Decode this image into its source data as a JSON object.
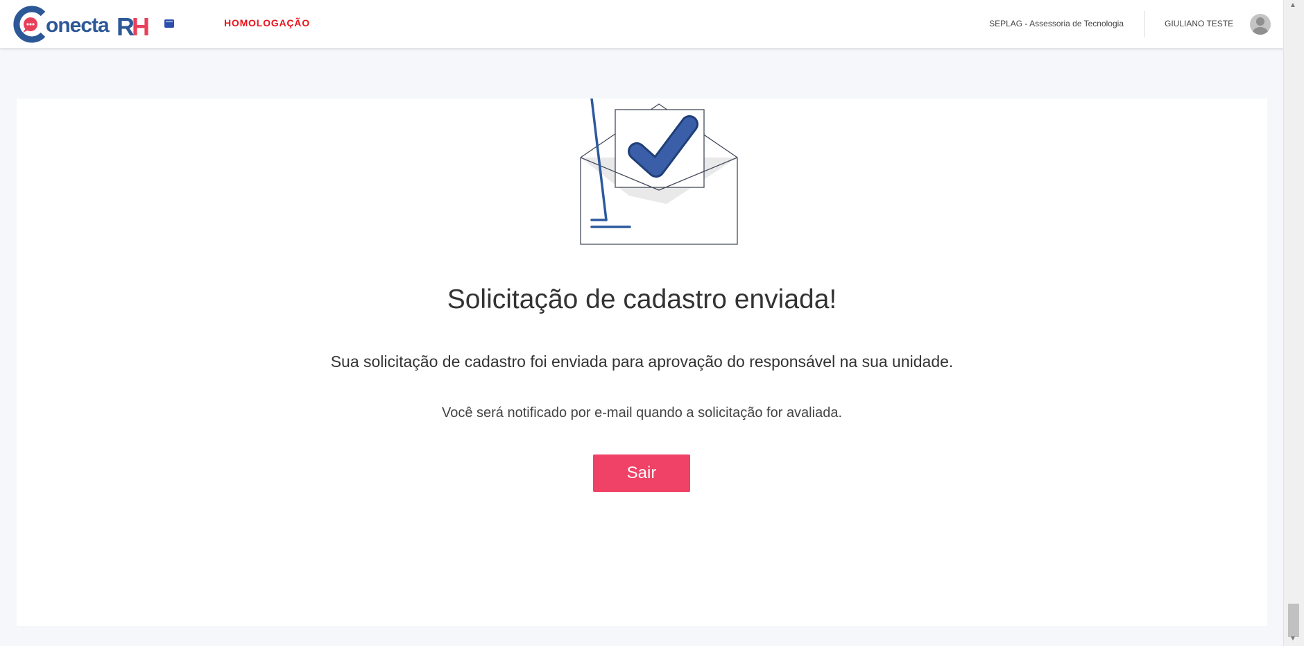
{
  "header": {
    "logo": {
      "text": "onecta",
      "rh_r": "R",
      "rh_h": "H",
      "brand_blue": "#2d5897",
      "brand_red": "#e8405a"
    },
    "menu_icon": "app-menu-icon",
    "environment_label": "HOMOLOGAÇÃO",
    "organization": "SEPLAG - Assessoria de Tecnologia",
    "user_name": "GIULIANO TESTE",
    "avatar_icon": "user-avatar-icon"
  },
  "main": {
    "illustration_icon": "envelope-check-icon",
    "title": "Solicitação de cadastro enviada!",
    "message": "Sua solicitação de cadastro foi enviada para aprovação do responsável na sua unidade.",
    "submessage": "Você será notificado por e-mail quando a solicitação for avaliada.",
    "exit_button_label": "Sair"
  },
  "scrollbar": {
    "up_icon": "▲",
    "down_icon": "▼"
  },
  "colors": {
    "accent": "#ef4266",
    "environment": "#e8141d",
    "check": "#2d5a9e",
    "background": "#f6f7fb"
  }
}
